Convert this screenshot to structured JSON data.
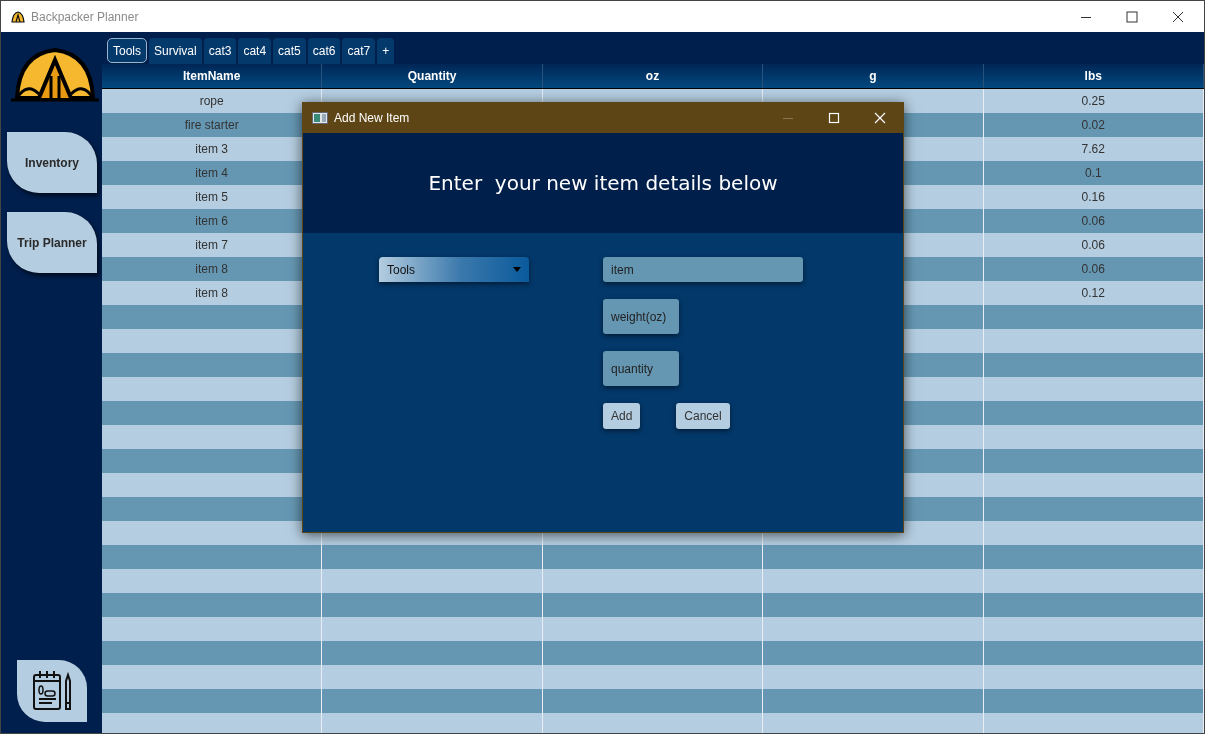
{
  "window": {
    "title": "Backpacker Planner"
  },
  "sidebar": {
    "items": [
      {
        "label": "Inventory"
      },
      {
        "label": "Trip Planner"
      }
    ]
  },
  "tabs": [
    {
      "label": "Tools",
      "selected": true
    },
    {
      "label": "Survival",
      "selected": false
    },
    {
      "label": "cat3",
      "selected": false
    },
    {
      "label": "cat4",
      "selected": false
    },
    {
      "label": "cat5",
      "selected": false
    },
    {
      "label": "cat6",
      "selected": false
    },
    {
      "label": "cat7",
      "selected": false
    },
    {
      "label": "+",
      "selected": false
    }
  ],
  "table": {
    "columns": [
      "ItemName",
      "Quantity",
      "oz",
      "g",
      "lbs"
    ],
    "rows": [
      {
        "name": "rope",
        "lbs": "0.25"
      },
      {
        "name": "fire starter",
        "lbs": "0.02"
      },
      {
        "name": "item 3",
        "lbs": "7.62"
      },
      {
        "name": "item 4",
        "lbs": "0.1"
      },
      {
        "name": "item 5",
        "lbs": "0.16"
      },
      {
        "name": "item 6",
        "lbs": "0.06"
      },
      {
        "name": "item 7",
        "lbs": "0.06"
      },
      {
        "name": "item 8",
        "lbs": "0.06"
      },
      {
        "name": "item 8",
        "lbs": "0.12"
      }
    ]
  },
  "dialog": {
    "title": "Add New Item",
    "heading": "Enter  your new item details below",
    "category": {
      "value": "Tools"
    },
    "fields": [
      {
        "placeholder": "item"
      },
      {
        "placeholder": "weight(oz)"
      },
      {
        "placeholder": "quantity"
      }
    ],
    "buttons": [
      "Add",
      "Cancel"
    ]
  }
}
